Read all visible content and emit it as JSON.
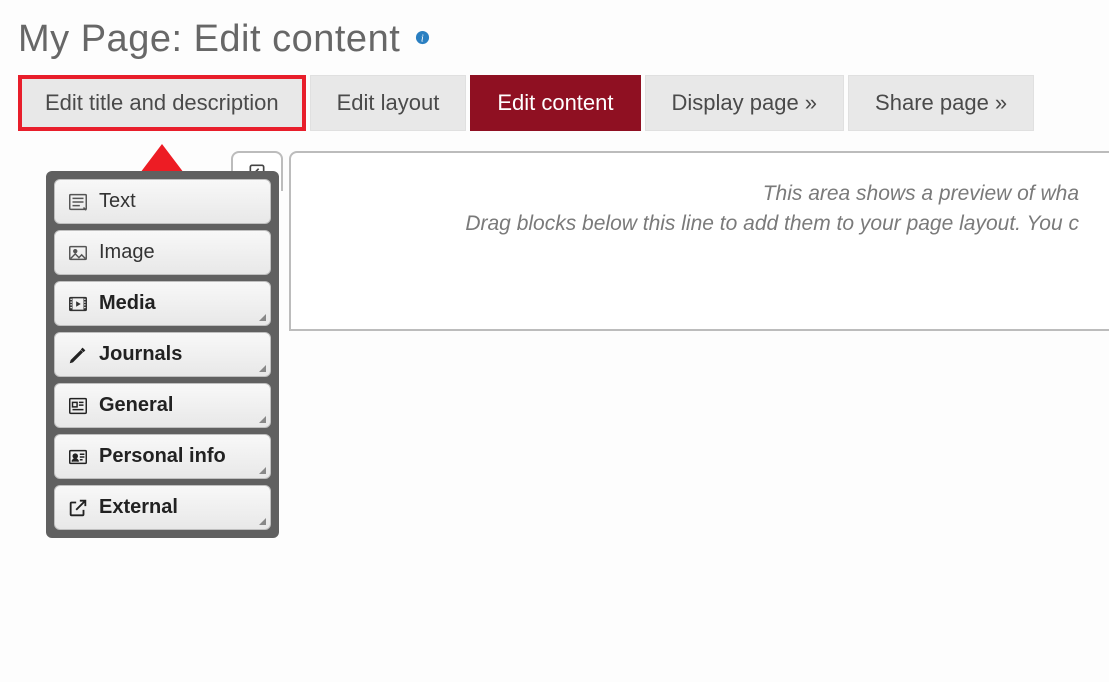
{
  "header": {
    "title": "My Page: Edit content"
  },
  "tabs": {
    "edit_title": "Edit title and description",
    "edit_layout": "Edit layout",
    "edit_content": "Edit content",
    "display_page": "Display page »",
    "share_page": "Share page »"
  },
  "sidebar": {
    "items": [
      {
        "label": "Text",
        "bold": false
      },
      {
        "label": "Image",
        "bold": false
      },
      {
        "label": "Media",
        "bold": true
      },
      {
        "label": "Journals",
        "bold": true
      },
      {
        "label": "General",
        "bold": true
      },
      {
        "label": "Personal info",
        "bold": true
      },
      {
        "label": "External",
        "bold": true
      }
    ]
  },
  "preview": {
    "line1": "This area shows a preview of wha",
    "line2": "Drag blocks below this line to add them to your page layout. You c"
  }
}
